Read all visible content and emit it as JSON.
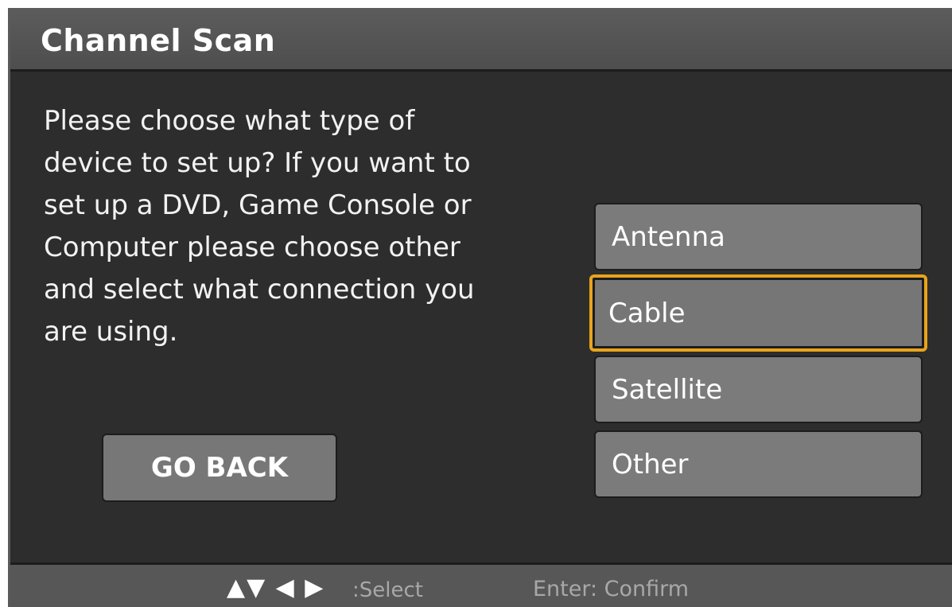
{
  "title": "Channel Scan",
  "description": "Please choose what type of device to set up? If you want to set up a DVD, Game Console or Computer please choose other and select what connection you are using.",
  "back_button": "GO BACK",
  "options": [
    {
      "label": "Antenna",
      "selected": false
    },
    {
      "label": "Cable",
      "selected": true
    },
    {
      "label": "Satellite",
      "selected": false
    },
    {
      "label": "Other",
      "selected": false
    }
  ],
  "footer": {
    "arrows": "▲▼ ◀ ▶",
    "select_hint": ":Select",
    "confirm_hint": "Enter: Confirm"
  },
  "colors": {
    "highlight": "#e8a41c",
    "background": "#2d2d2d",
    "button": "#7b7b7b"
  }
}
